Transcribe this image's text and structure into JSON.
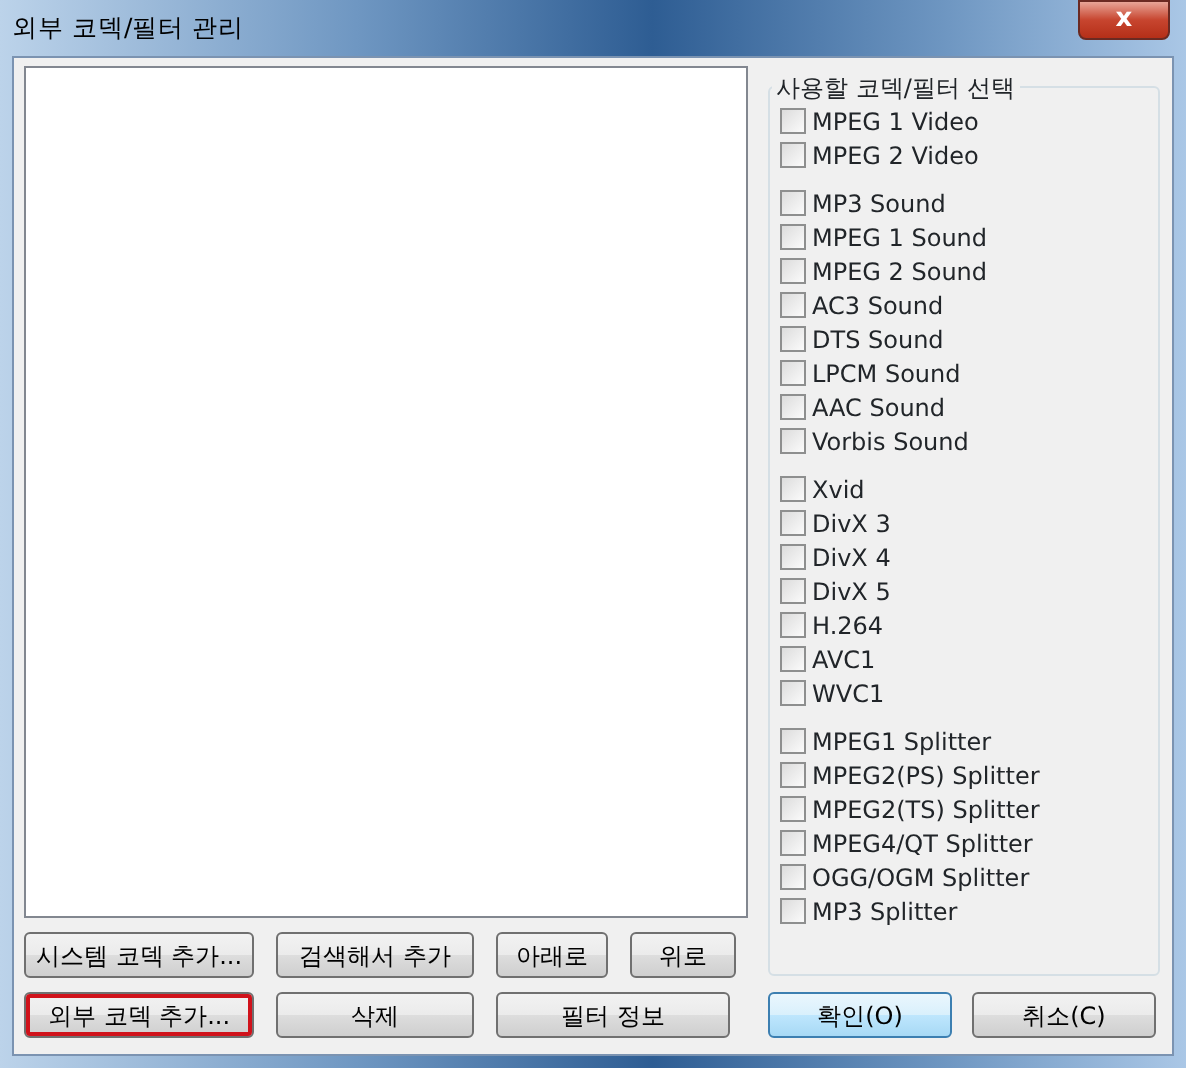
{
  "window": {
    "title": "외부 코덱/필터 관리",
    "close_label": "x"
  },
  "filter_group": {
    "title": "사용할 코덱/필터 선택",
    "groups": [
      {
        "items": [
          {
            "label": "MPEG 1 Video",
            "checked": false
          },
          {
            "label": "MPEG 2 Video",
            "checked": false
          }
        ]
      },
      {
        "items": [
          {
            "label": "MP3 Sound",
            "checked": false
          },
          {
            "label": "MPEG 1 Sound",
            "checked": false
          },
          {
            "label": "MPEG 2 Sound",
            "checked": false
          },
          {
            "label": "AC3 Sound",
            "checked": false
          },
          {
            "label": "DTS Sound",
            "checked": false
          },
          {
            "label": "LPCM Sound",
            "checked": false
          },
          {
            "label": "AAC Sound",
            "checked": false
          },
          {
            "label": "Vorbis Sound",
            "checked": false
          }
        ]
      },
      {
        "items": [
          {
            "label": "Xvid",
            "checked": false
          },
          {
            "label": "DivX 3",
            "checked": false
          },
          {
            "label": "DivX 4",
            "checked": false
          },
          {
            "label": "DivX 5",
            "checked": false
          },
          {
            "label": "H.264",
            "checked": false
          },
          {
            "label": "AVC1",
            "checked": false
          },
          {
            "label": "WVC1",
            "checked": false
          }
        ]
      },
      {
        "items": [
          {
            "label": "MPEG1 Splitter",
            "checked": false
          },
          {
            "label": "MPEG2(PS) Splitter",
            "checked": false
          },
          {
            "label": "MPEG2(TS) Splitter",
            "checked": false
          },
          {
            "label": "MPEG4/QT Splitter",
            "checked": false
          },
          {
            "label": "OGG/OGM Splitter",
            "checked": false
          },
          {
            "label": "MP3 Splitter",
            "checked": false
          }
        ]
      }
    ]
  },
  "list_buttons": [
    [
      {
        "label": "시스템 코덱 추가...",
        "highlighted": false
      },
      {
        "label": "검색해서 추가",
        "highlighted": false
      },
      {
        "label": "아래로",
        "highlighted": false
      },
      {
        "label": "위로",
        "highlighted": false
      }
    ],
    [
      {
        "label": "외부 코덱 추가...",
        "highlighted": true
      },
      {
        "label": "삭제",
        "highlighted": false
      },
      {
        "label": "필터 정보",
        "highlighted": false
      }
    ]
  ],
  "dialog_buttons": [
    {
      "label": "확인(O)",
      "default": true
    },
    {
      "label": "취소(C)",
      "default": false
    }
  ]
}
